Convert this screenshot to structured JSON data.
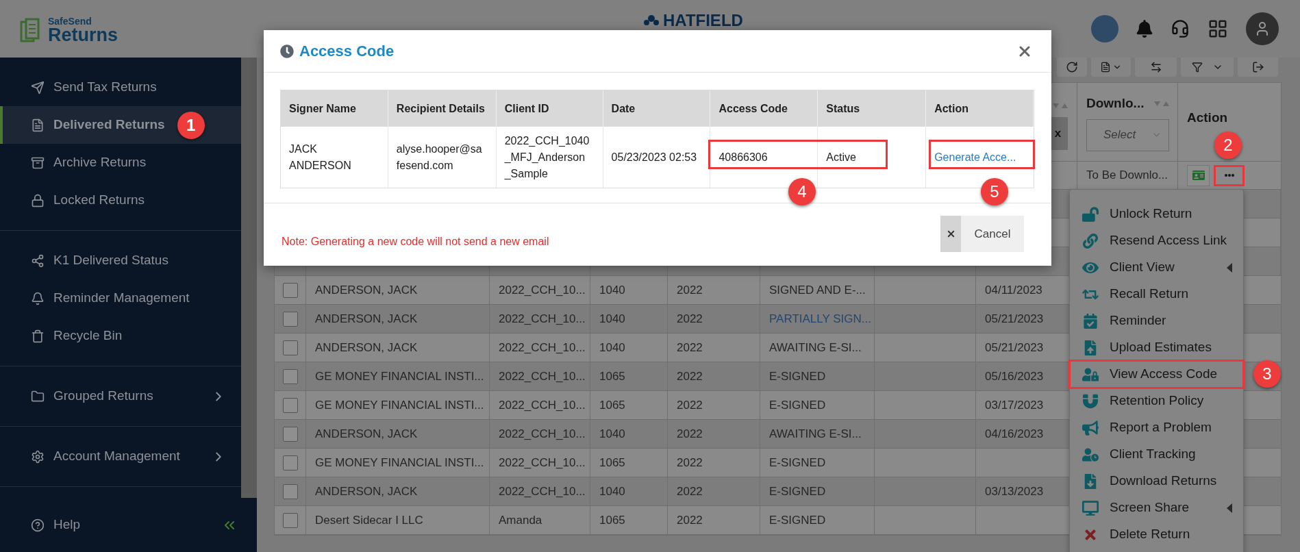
{
  "header": {
    "brand_small": "SafeSend",
    "brand_large": "Returns",
    "firm_name": "HATFIELD"
  },
  "sidebar": {
    "groups": [
      [
        {
          "label": "Send Tax Returns",
          "selected": false,
          "has_submenu": false
        },
        {
          "label": "Delivered Returns",
          "selected": true,
          "has_submenu": false,
          "callout": "1"
        },
        {
          "label": "Archive Returns",
          "selected": false,
          "has_submenu": false
        },
        {
          "label": "Locked Returns",
          "selected": false,
          "has_submenu": false
        }
      ],
      [
        {
          "label": "K1 Delivered Status",
          "selected": false,
          "has_submenu": false
        },
        {
          "label": "Reminder Management",
          "selected": false,
          "has_submenu": false
        },
        {
          "label": "Recycle Bin",
          "selected": false,
          "has_submenu": false
        }
      ],
      [
        {
          "label": "Grouped Returns",
          "selected": false,
          "has_submenu": true
        }
      ],
      [
        {
          "label": "Account Management",
          "selected": false,
          "has_submenu": true
        }
      ]
    ],
    "help": "Help"
  },
  "table": {
    "date_filter_clear": "x",
    "download_column": "Downlo...",
    "download_filter_placeholder": "Select",
    "action_column": "Action",
    "top_row": {
      "download_status": "To Be Downlo...",
      "more_highlighted": true,
      "callout": "2"
    },
    "rows": [
      {
        "checked": false,
        "name": "ANDERSON, JACK",
        "client_id": "2022_CCH_10...",
        "type": "1040",
        "year": "2022",
        "status": "SIGNED AND E-...",
        "status_link": false,
        "date": "04/11/2023"
      },
      {
        "checked": false,
        "name": "ANDERSON, JACK",
        "client_id": "2022_CCH_10...",
        "type": "1040",
        "year": "2022",
        "status": "PARTIALLY SIGN...",
        "status_link": true,
        "date": "05/21/2023"
      },
      {
        "checked": false,
        "name": "ANDERSON, JACK",
        "client_id": "2022_CCH_10...",
        "type": "1040",
        "year": "2022",
        "status": "AWAITING E-SI...",
        "status_link": false,
        "date": "05/21/2023"
      },
      {
        "checked": false,
        "name": "GE MONEY FINANCIAL INSTI...",
        "client_id": "2022_CCH_10...",
        "type": "1065",
        "year": "2022",
        "status": "E-SIGNED",
        "status_link": false,
        "date": "05/16/2023"
      },
      {
        "checked": false,
        "name": "GE MONEY FINANCIAL INSTI...",
        "client_id": "2022_CCH_10...",
        "type": "1065",
        "year": "2022",
        "status": "E-SIGNED",
        "status_link": false,
        "date": "03/17/2023"
      },
      {
        "checked": false,
        "name": "ANDERSON, JACK",
        "client_id": "2022_CCH_10...",
        "type": "1040",
        "year": "2022",
        "status": "AWAITING E-SI...",
        "status_link": false,
        "date": "04/16/2023"
      },
      {
        "checked": false,
        "name": "GE MONEY FINANCIAL INSTI...",
        "client_id": "2022_CCH_10...",
        "type": "1065",
        "year": "2022",
        "status": "E-SIGNED",
        "status_link": false
      },
      {
        "checked": false,
        "name": "ANDERSON, JACK",
        "client_id": "2022_CCH_10...",
        "type": "1040",
        "year": "2022",
        "status": "E-SIGNED",
        "status_link": false,
        "date": "03/13/2023"
      },
      {
        "checked": false,
        "name": "Desert Sidecar I LLC",
        "client_id": "Amanda",
        "type": "1065",
        "year": "2022",
        "status": "E-SIGNED",
        "status_link": false
      }
    ]
  },
  "menu": {
    "items": [
      {
        "label": "Unlock Return",
        "has_submenu": false,
        "highlighted": false
      },
      {
        "label": "Resend Access Link",
        "has_submenu": false,
        "highlighted": false
      },
      {
        "label": "Client View",
        "has_submenu": true,
        "highlighted": false
      },
      {
        "label": "Recall Return",
        "has_submenu": false,
        "highlighted": false
      },
      {
        "label": "Reminder",
        "has_submenu": false,
        "highlighted": false
      },
      {
        "label": "Upload Estimates",
        "has_submenu": false,
        "highlighted": false
      },
      {
        "label": "View Access Code",
        "has_submenu": false,
        "highlighted": true,
        "callout": "3"
      },
      {
        "label": "Retention Policy",
        "has_submenu": false,
        "highlighted": false
      },
      {
        "label": "Report a Problem",
        "has_submenu": false,
        "highlighted": false
      },
      {
        "label": "Client Tracking",
        "has_submenu": false,
        "highlighted": false
      },
      {
        "label": "Download Returns",
        "has_submenu": false,
        "highlighted": false
      },
      {
        "label": "Screen Share",
        "has_submenu": true,
        "highlighted": false
      },
      {
        "label": "Delete Return",
        "has_submenu": false,
        "highlighted": false
      }
    ]
  },
  "modal": {
    "title": "Access Code",
    "columns": [
      "Signer Name",
      "Recipient Details",
      "Client ID",
      "Date",
      "Access Code",
      "Status",
      "Action"
    ],
    "rows": [
      {
        "signer": "JACK ANDERSON",
        "recipient": "alyse.hooper@safesend.com",
        "client_id": "2022_CCH_1040_MFJ_Anderson_Sample",
        "date": "05/23/2023 02:53",
        "access_code": "40866306",
        "status": "Active",
        "action": "Generate Acce..."
      }
    ],
    "annotations": [
      {
        "kind": "code",
        "callout": "4"
      },
      {
        "kind": "action",
        "callout": "5"
      }
    ],
    "note": "Note: Generating a new code will not send a new email",
    "cancel": "Cancel"
  }
}
